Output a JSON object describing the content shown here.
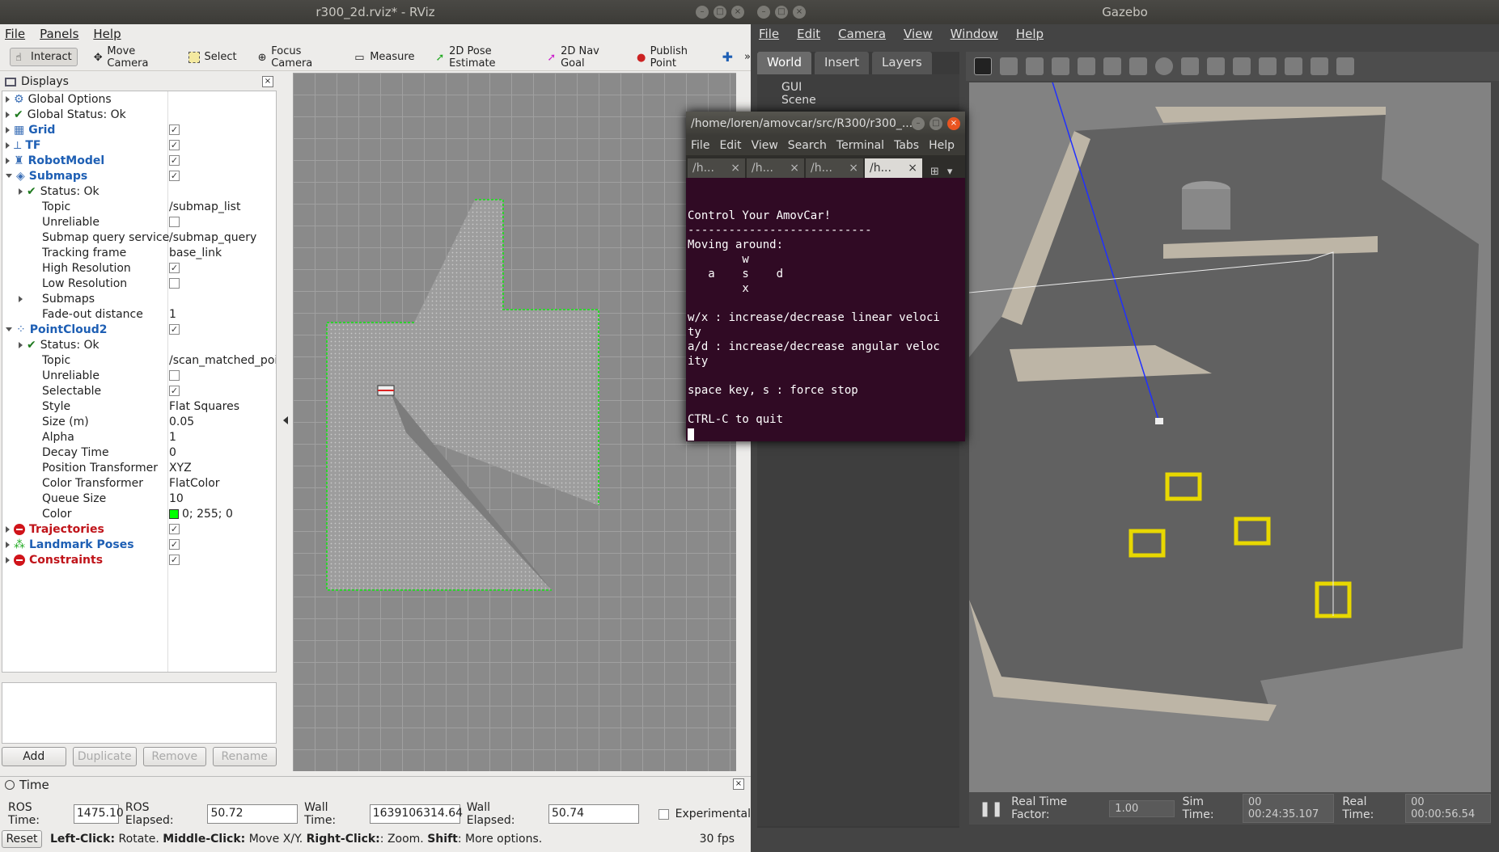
{
  "rviz": {
    "title": "r300_2d.rviz* - RViz",
    "menu": [
      "File",
      "Panels",
      "Help"
    ],
    "tools": [
      "Interact",
      "Move Camera",
      "Select",
      "Focus Camera",
      "Measure",
      "2D Pose Estimate",
      "2D Nav Goal",
      "Publish Point"
    ],
    "displays_title": "Displays",
    "tree": [
      {
        "label": "Global Options",
        "val": "",
        "indent": 0,
        "style": "",
        "icon": "gear",
        "arrow": "closed"
      },
      {
        "label": "Global Status: Ok",
        "val": "",
        "indent": 0,
        "style": "",
        "icon": "tick",
        "arrow": "closed"
      },
      {
        "label": "Grid",
        "val": "chk",
        "indent": 0,
        "style": "blue",
        "icon": "grid",
        "arrow": "closed"
      },
      {
        "label": "TF",
        "val": "chk",
        "indent": 0,
        "style": "blue",
        "icon": "tf",
        "arrow": "closed"
      },
      {
        "label": "RobotModel",
        "val": "chk",
        "indent": 0,
        "style": "blue",
        "icon": "robot",
        "arrow": "closed"
      },
      {
        "label": "Submaps",
        "val": "chk",
        "indent": 0,
        "style": "blue",
        "icon": "submaps",
        "arrow": "open"
      },
      {
        "label": "Status: Ok",
        "val": "",
        "indent": 1,
        "style": "",
        "icon": "tick",
        "arrow": "closed"
      },
      {
        "label": "Topic",
        "val": "/submap_list",
        "indent": 1,
        "style": "",
        "icon": "",
        "arrow": ""
      },
      {
        "label": "Unreliable",
        "val": "unchk",
        "indent": 1,
        "style": "",
        "icon": "",
        "arrow": ""
      },
      {
        "label": "Submap query service",
        "val": "/submap_query",
        "indent": 1,
        "style": "",
        "icon": "",
        "arrow": ""
      },
      {
        "label": "Tracking frame",
        "val": "base_link",
        "indent": 1,
        "style": "",
        "icon": "",
        "arrow": ""
      },
      {
        "label": "High Resolution",
        "val": "chk",
        "indent": 1,
        "style": "",
        "icon": "",
        "arrow": ""
      },
      {
        "label": "Low Resolution",
        "val": "unchk",
        "indent": 1,
        "style": "",
        "icon": "",
        "arrow": ""
      },
      {
        "label": "Submaps",
        "val": "",
        "indent": 1,
        "style": "",
        "icon": "",
        "arrow": "closed"
      },
      {
        "label": "Fade-out distance",
        "val": "1",
        "indent": 1,
        "style": "",
        "icon": "",
        "arrow": ""
      },
      {
        "label": "PointCloud2",
        "val": "chk",
        "indent": 0,
        "style": "blue",
        "icon": "cloud",
        "arrow": "open"
      },
      {
        "label": "Status: Ok",
        "val": "",
        "indent": 1,
        "style": "",
        "icon": "tick",
        "arrow": "closed"
      },
      {
        "label": "Topic",
        "val": "/scan_matched_poi",
        "indent": 1,
        "style": "",
        "icon": "",
        "arrow": ""
      },
      {
        "label": "Unreliable",
        "val": "unchk",
        "indent": 1,
        "style": "",
        "icon": "",
        "arrow": ""
      },
      {
        "label": "Selectable",
        "val": "chk",
        "indent": 1,
        "style": "",
        "icon": "",
        "arrow": ""
      },
      {
        "label": "Style",
        "val": "Flat Squares",
        "indent": 1,
        "style": "",
        "icon": "",
        "arrow": ""
      },
      {
        "label": "Size (m)",
        "val": "0.05",
        "indent": 1,
        "style": "",
        "icon": "",
        "arrow": ""
      },
      {
        "label": "Alpha",
        "val": "1",
        "indent": 1,
        "style": "",
        "icon": "",
        "arrow": ""
      },
      {
        "label": "Decay Time",
        "val": "0",
        "indent": 1,
        "style": "",
        "icon": "",
        "arrow": ""
      },
      {
        "label": "Position Transformer",
        "val": "XYZ",
        "indent": 1,
        "style": "",
        "icon": "",
        "arrow": ""
      },
      {
        "label": "Color Transformer",
        "val": "FlatColor",
        "indent": 1,
        "style": "",
        "icon": "",
        "arrow": ""
      },
      {
        "label": "Queue Size",
        "val": "10",
        "indent": 1,
        "style": "",
        "icon": "",
        "arrow": ""
      },
      {
        "label": "Color",
        "val": "color:0; 255; 0",
        "indent": 1,
        "style": "",
        "icon": "",
        "arrow": ""
      },
      {
        "label": "Trajectories",
        "val": "chk",
        "indent": 0,
        "style": "red",
        "icon": "stop",
        "arrow": "closed"
      },
      {
        "label": "Landmark Poses",
        "val": "chk",
        "indent": 0,
        "style": "blue",
        "icon": "landmark",
        "arrow": "closed"
      },
      {
        "label": "Constraints",
        "val": "chk",
        "indent": 0,
        "style": "red",
        "icon": "stop",
        "arrow": "closed"
      }
    ],
    "buttons": {
      "add": "Add",
      "duplicate": "Duplicate",
      "remove": "Remove",
      "rename": "Rename"
    },
    "time": {
      "title": "Time",
      "ros_time_label": "ROS Time:",
      "ros_time": "1475.10",
      "ros_elapsed_label": "ROS Elapsed:",
      "ros_elapsed": "50.72",
      "wall_time_label": "Wall Time:",
      "wall_time": "1639106314.64",
      "wall_elapsed_label": "Wall Elapsed:",
      "wall_elapsed": "50.74",
      "experimental": "Experimental"
    },
    "status": {
      "reset": "Reset",
      "left": "Left-Click:",
      "left_t": " Rotate. ",
      "middle": "Middle-Click:",
      "middle_t": " Move X/Y. ",
      "right": "Right-Click:",
      "right_t": ": Zoom. ",
      "shift": "Shift",
      "shift_t": ": More options.",
      "fps": "30 fps"
    }
  },
  "gazebo": {
    "title": "Gazebo",
    "menu": [
      "File",
      "Edit",
      "Camera",
      "View",
      "Window",
      "Help"
    ],
    "tabs": [
      "World",
      "Insert",
      "Layers"
    ],
    "tree": [
      "GUI",
      "Scene"
    ],
    "rtf_label": "Real Time Factor:",
    "rtf": "1.00",
    "sim_label": "Sim Time:",
    "sim": "00 00:24:35.107",
    "real_label": "Real Time:",
    "real": "00 00:00:56.54"
  },
  "terminal": {
    "title": "/home/loren/amovcar/src/R300/r300_...",
    "menu": [
      "File",
      "Edit",
      "View",
      "Search",
      "Terminal",
      "Tabs",
      "Help"
    ],
    "tabs": [
      "/h...",
      "/h...",
      "/h...",
      "/h..."
    ],
    "body": "\nControl Your AmovCar!\n---------------------------\nMoving around:\n        w\n   a    s    d\n        x\n\nw/x : increase/decrease linear veloci\nty\na/d : increase/decrease angular veloc\nity\n\nspace key, s : force stop\n\nCTRL-C to quit\n"
  },
  "colors": {
    "pointcloud": "#00ff00",
    "terminal_bg": "#300a24",
    "ubuntu_dark": "#3c3b37"
  }
}
